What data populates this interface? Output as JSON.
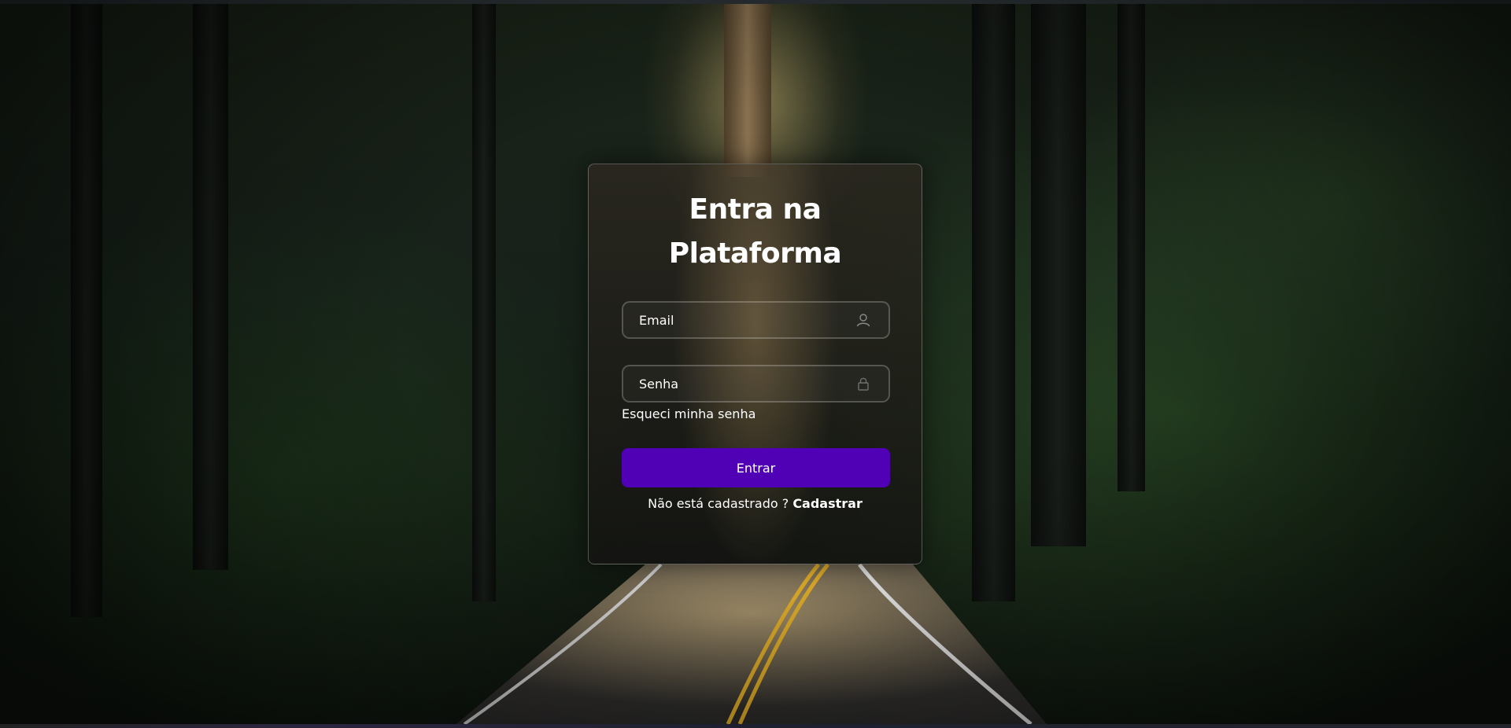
{
  "login": {
    "title_line1": "Entra na",
    "title_line2": "Plataforma",
    "email_placeholder": "Email",
    "email_icon": "user-icon",
    "password_placeholder": "Senha",
    "password_icon": "lock-icon",
    "forgot_label": "Esqueci minha senha",
    "submit_label": "Entrar",
    "signup_prompt": "Não está cadastrado ?",
    "signup_link": "Cadastrar"
  },
  "colors": {
    "primary_button": "#5000b5",
    "text": "#ffffff",
    "card_border": "rgba(255,255,255,0.28)"
  }
}
